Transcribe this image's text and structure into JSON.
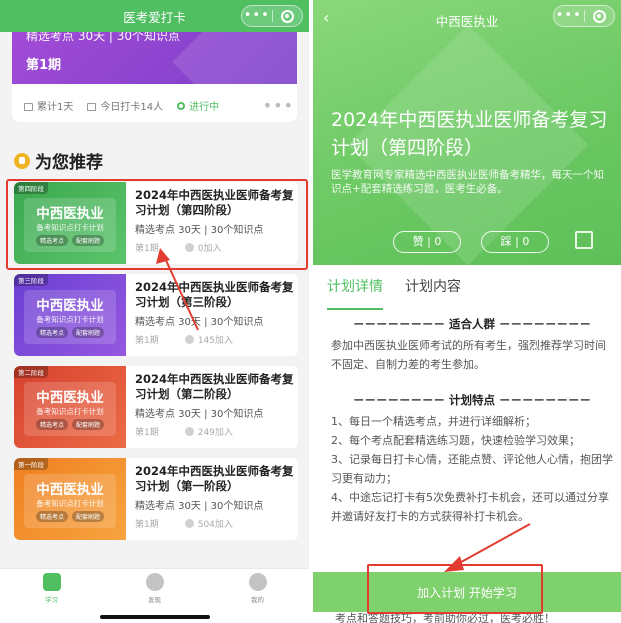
{
  "left": {
    "nav_title": "医考爱打卡",
    "capsule_dots": "•••",
    "current": {
      "subtitle": "精选考点   30天 | 30个知识点",
      "period": "第1期",
      "stat_total": "累计1天",
      "stat_today": "今日打卡14人",
      "status": "进行中",
      "more": "•••"
    },
    "section_title": "为您推荐",
    "plans": [
      {
        "stage": "第四阶段",
        "thumb_title": "中西医执业",
        "thumb_sub": "备考知识点打卡计划",
        "tag1": "精选考点",
        "tag2": "配套刷题",
        "name": "2024年中西医执业医师备考复习计划（第四阶段）",
        "meta": "精选考点  30天 | 30个知识点",
        "period": "第1期",
        "joined": "0加入"
      },
      {
        "stage": "第三阶段",
        "thumb_title": "中西医执业",
        "thumb_sub": "备考知识点打卡计划",
        "tag1": "精选考点",
        "tag2": "配套刷题",
        "name": "2024年中西医执业医师备考复习计划（第三阶段）",
        "meta": "精选考点  30天 | 30个知识点",
        "period": "第1期",
        "joined": "145加入"
      },
      {
        "stage": "第二阶段",
        "thumb_title": "中西医执业",
        "thumb_sub": "备考知识点打卡计划",
        "tag1": "精选考点",
        "tag2": "配套刷题",
        "name": "2024年中西医执业医师备考复习计划（第二阶段）",
        "meta": "精选考点  30天 | 30个知识点",
        "period": "第1期",
        "joined": "249加入"
      },
      {
        "stage": "第一阶段",
        "thumb_title": "中西医执业",
        "thumb_sub": "备考知识点打卡计划",
        "tag1": "精选考点",
        "tag2": "配套刷题",
        "name": "2024年中西医执业医师备考复习计划（第一阶段）",
        "meta": "精选考点  30天 | 30个知识点",
        "period": "第1期",
        "joined": "504加入"
      }
    ],
    "tabs": [
      {
        "label": "学习",
        "active": true
      },
      {
        "label": "发现",
        "active": false
      },
      {
        "label": "我的",
        "active": false
      }
    ]
  },
  "right": {
    "nav_title": "中西医执业",
    "back": "‹",
    "heading": "2024年中西医执业医师备考复习计划（第四阶段）",
    "description": "医学教育网专家精选中西医执业医师备考精华，每天一个知识点+配套精选练习题，医考生必备。",
    "like": "赞 | 0",
    "dislike": "踩 | 0",
    "tab_detail": "计划详情",
    "tab_content": "计划内容",
    "section1_title": "－－－－－－－－   适合人群   －－－－－－－－",
    "section1_text": "参加中西医执业医师考试的所有考生，强烈推荐学习时间不固定、自制力差的考生参加。",
    "section2_title": "－－－－－－－－   计划特点   －－－－－－－－",
    "features": [
      "1、每日一个精选考点，并进行详细解析；",
      "2、每个考点配套精选练习题，快速检验学习效果；",
      "3、记录每日打卡心情，还能点赞、评论他人心情，抱团学习更有动力；",
      "4、中途忘记打卡有5次免费补打卡机会，还可以通过分享并邀请好友打卡的方式获得补打卡机会。"
    ],
    "join_button": "加入计划  开始学习",
    "footer_text": "考点和答题技巧，考前助你必过，医考必胜！"
  },
  "colors": {
    "brand_green": "#4fbf61",
    "annotation_red": "#e23b2f"
  }
}
